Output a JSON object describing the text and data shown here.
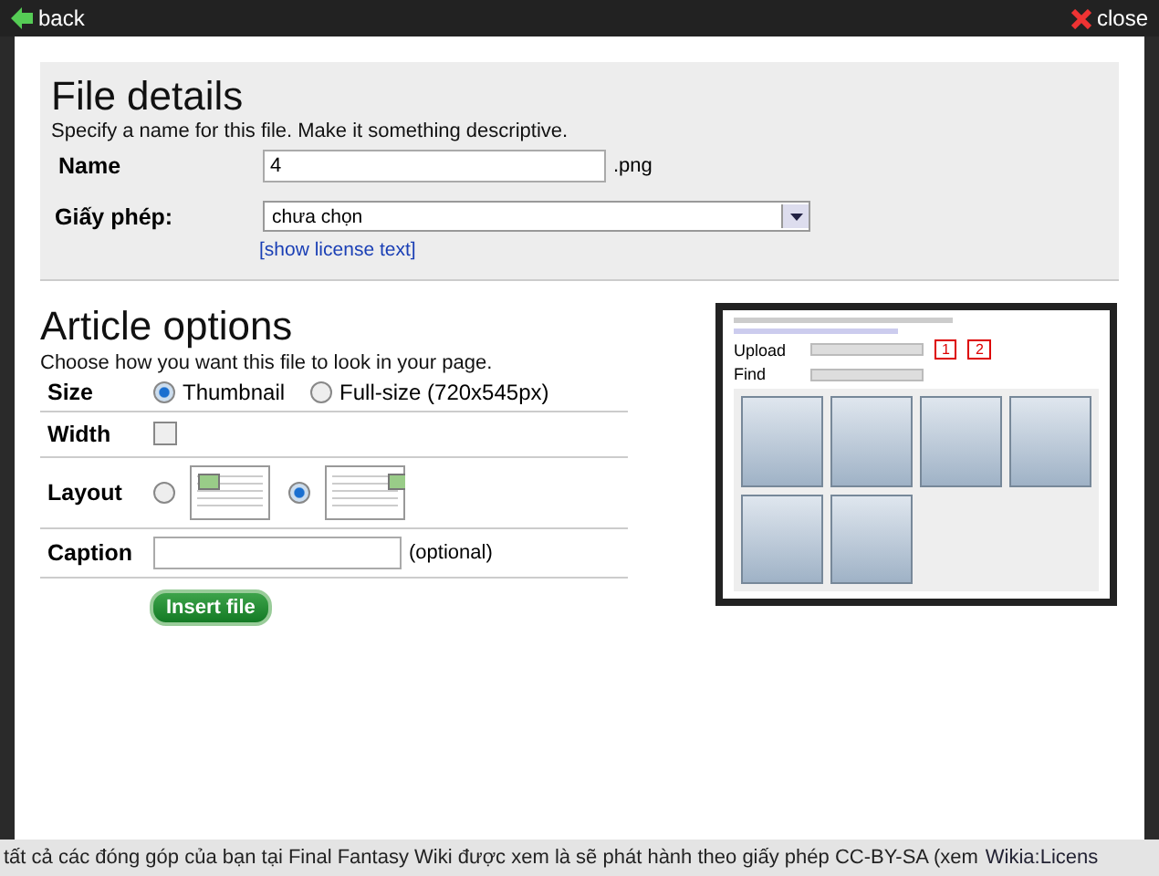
{
  "background_page": {
    "bottom_line": "tất cả các đóng góp của bạn tại Final Fantasy Wiki được xem là sẽ phát hành theo giấy phép CC-BY-SA (xem",
    "bottom_link": "Wikia:Licens"
  },
  "header": {
    "back": "back",
    "close": "close"
  },
  "file_details": {
    "title": "File details",
    "description": "Specify a name for this file. Make it something descriptive.",
    "name_label": "Name",
    "name_value": "4",
    "extension": ".png",
    "license_label": "Giấy phép:",
    "license_value": "chưa chọn",
    "license_link": "[show license text]"
  },
  "article_options": {
    "title": "Article options",
    "description": "Choose how you want this file to look in your page.",
    "size_label": "Size",
    "size_options": [
      {
        "label": "Thumbnail",
        "selected": true
      },
      {
        "label": "Full-size (720x545px)",
        "selected": false
      }
    ],
    "width_label": "Width",
    "width_checked": false,
    "layout_label": "Layout",
    "layout_options": [
      {
        "kind": "left",
        "selected": false
      },
      {
        "kind": "right",
        "selected": true
      }
    ],
    "caption_label": "Caption",
    "caption_hint": "(optional)",
    "insert_button": "Insert file"
  },
  "preview": {
    "upload_label": "Upload",
    "find_label": "Find",
    "markers": [
      "1",
      "2"
    ]
  }
}
